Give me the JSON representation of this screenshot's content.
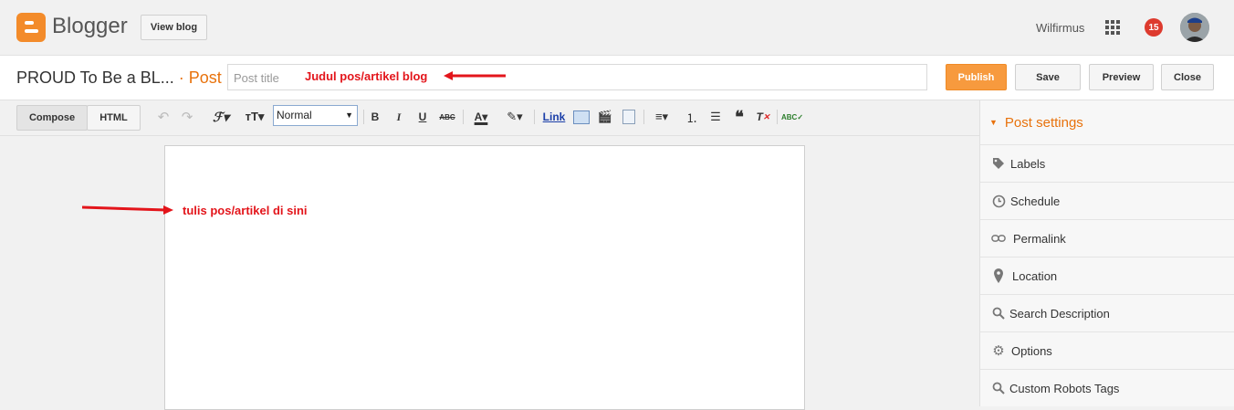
{
  "header": {
    "brand": "Blogger",
    "view_blog": "View blog",
    "user_name": "Wilfirmus",
    "notification_count": "15"
  },
  "titlebar": {
    "blog_name": "PROUD To Be a BL...",
    "separator": " · ",
    "post_label": "Post",
    "title_placeholder": "Post title",
    "annotation": "Judul pos/artikel blog",
    "publish": "Publish",
    "save": "Save",
    "preview": "Preview",
    "close": "Close"
  },
  "toolbar": {
    "compose": "Compose",
    "html": "HTML",
    "format_select": "Normal",
    "link": "Link"
  },
  "editor": {
    "annotation": "tulis pos/artikel di sini"
  },
  "sidebar": {
    "heading": "Post settings",
    "items": [
      {
        "label": "Labels",
        "icon": "tag-icon"
      },
      {
        "label": "Schedule",
        "icon": "clock-icon"
      },
      {
        "label": "Permalink",
        "icon": "link-icon"
      },
      {
        "label": "Location",
        "icon": "pin-icon"
      },
      {
        "label": "Search Description",
        "icon": "search-icon"
      },
      {
        "label": "Options",
        "icon": "gear-icon"
      },
      {
        "label": "Custom Robots Tags",
        "icon": "search-icon"
      }
    ]
  },
  "colors": {
    "accent": "#e8720c",
    "publish": "#f79a3e",
    "annotation": "#e3151b",
    "notification": "#dd3a2e"
  }
}
